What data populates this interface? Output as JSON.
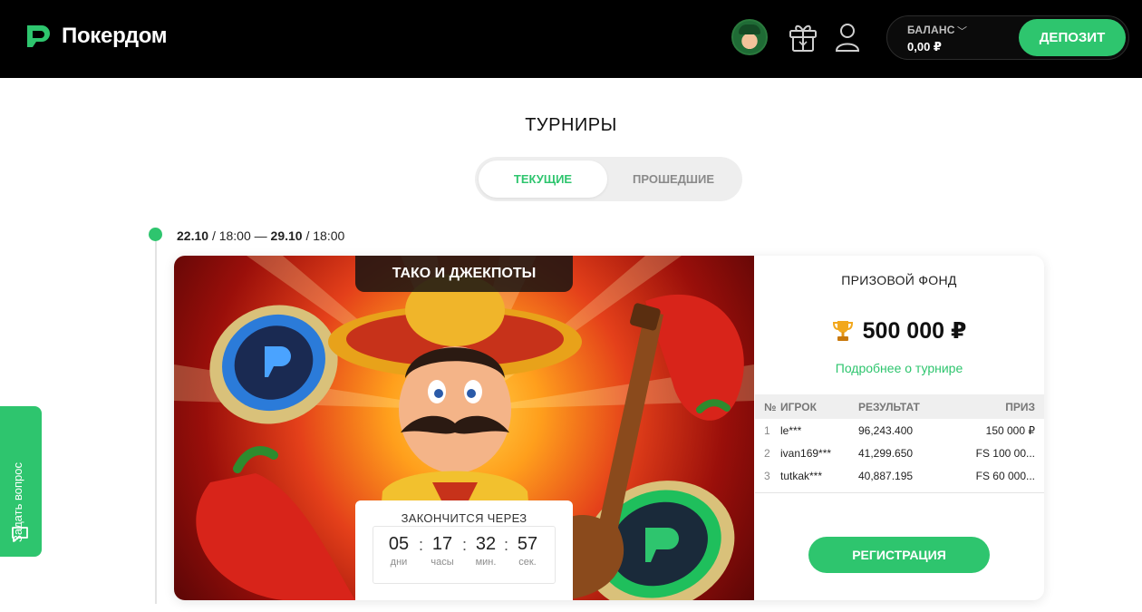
{
  "header": {
    "logo_text": "Покердом",
    "balance_label": "БАЛАНС",
    "balance_value": "0,00 ₽",
    "deposit_label": "ДЕПОЗИТ"
  },
  "page": {
    "title": "ТУРНИРЫ",
    "tabs": [
      {
        "label": "ТЕКУЩИЕ",
        "active": true
      },
      {
        "label": "ПРОШЕДШИЕ",
        "active": false
      }
    ]
  },
  "tournament": {
    "date_start": "22.10",
    "time_start": "18:00",
    "date_end": "29.10",
    "time_end": "18:00",
    "name": "ТАКО И ДЖЕКПОТЫ",
    "countdown": {
      "label": "ЗАКОНЧИТСЯ ЧЕРЕЗ",
      "days": "05",
      "days_unit": "дни",
      "hours": "17",
      "hours_unit": "часы",
      "minutes": "32",
      "minutes_unit": "мин.",
      "seconds": "57",
      "seconds_unit": "сек."
    },
    "prize_fund_label": "ПРИЗОВОЙ ФОНД",
    "prize_fund_value": "500 000 ₽",
    "details_link": "Подробнее о турнире",
    "table": {
      "headers": {
        "no": "№",
        "player": "ИГРОК",
        "result": "РЕЗУЛЬТАТ",
        "prize": "ПРИЗ"
      },
      "rows": [
        {
          "no": "1",
          "player": "le***",
          "result": "96,243.400",
          "prize": "150 000 ₽"
        },
        {
          "no": "2",
          "player": "ivan169***",
          "result": "41,299.650",
          "prize": "FS 100 00..."
        },
        {
          "no": "3",
          "player": "tutkak***",
          "result": "40,887.195",
          "prize": "FS 60 000..."
        }
      ]
    },
    "register_label": "РЕГИСТРАЦИЯ"
  },
  "side": {
    "ask_label": "Задать вопрос"
  },
  "colors": {
    "accent": "#2ec56e",
    "header_bg": "#000000"
  }
}
